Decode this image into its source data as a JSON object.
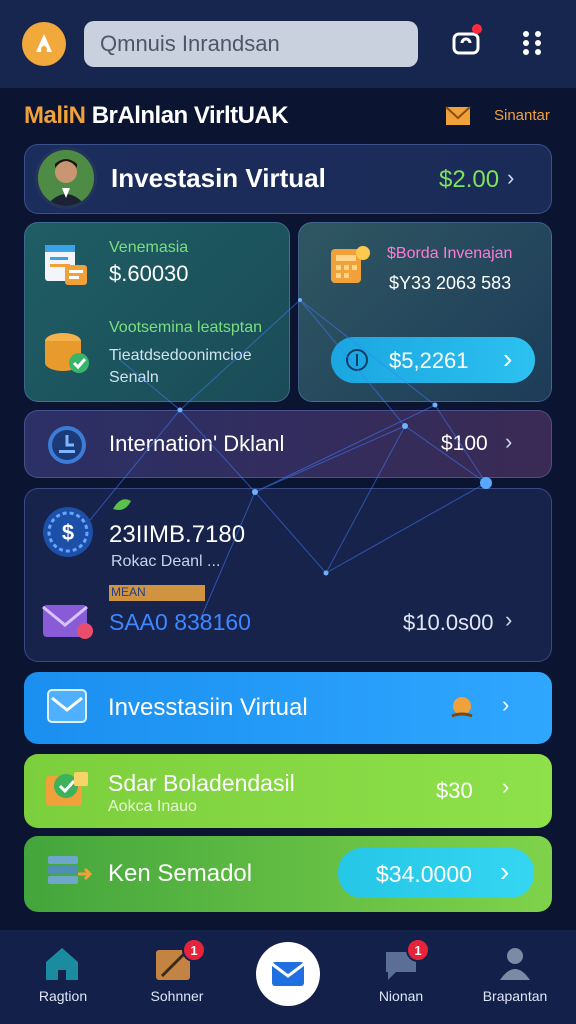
{
  "header": {
    "search_placeholder": "Qmnuis Inrandsan"
  },
  "section": {
    "title_lead": "MaliN",
    "title_rest": "BrAlnlan VirltUAK",
    "link_label": "Sinantar"
  },
  "profile": {
    "title": "Investasin Virtual",
    "value": "$2.00"
  },
  "teal_card": {
    "label1": "Venemasia",
    "value1": "$.60030",
    "label2": "Vootsemina leatsptan",
    "sub1": "Tieatdsedoonimcioe",
    "sub2": "Senaln"
  },
  "right_card": {
    "title": "$Borda Invenajan",
    "value": "$Y33 2063 583",
    "pill_value": "$5,2261"
  },
  "info": {
    "title": "Internation' Dklanl",
    "value": "$100"
  },
  "big_card": {
    "number": "23IIMB.7180",
    "sub": "Rokac Deanl ...",
    "tag": "MEAN",
    "code": "SAA0 838160",
    "value": "$10.0s00"
  },
  "blue_item": {
    "title": "Invesstasiin Virtual"
  },
  "green_item": {
    "title": "Sdar Boladendasil",
    "subtitle": "Aokca Inauo",
    "value": "$30"
  },
  "green_item2": {
    "title": "Ken Semadol",
    "value": "$34.0000"
  },
  "nav": {
    "items": [
      {
        "label": "Ragtion"
      },
      {
        "label": "Sohnner",
        "badge": "1"
      },
      {
        "label": "Nionan",
        "badge": "1"
      },
      {
        "label": "Brapantan"
      }
    ]
  },
  "colors": {
    "accent_orange": "#f0a13a",
    "green_value": "#7de35c",
    "blue_card": "#1a8ff0",
    "green_card": "#7ccf3c",
    "background": "#0b1532"
  }
}
